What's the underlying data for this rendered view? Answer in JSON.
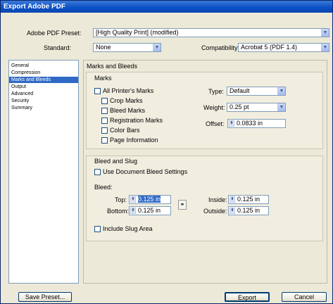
{
  "window": {
    "title": "Export Adobe PDF"
  },
  "header": {
    "preset_label": "Adobe PDF Preset:",
    "preset_value": "[High Quality Print] (modified)",
    "standard_label": "Standard:",
    "standard_value": "None",
    "compat_label": "Compatibility:",
    "compat_value": "Acrobat 5 (PDF 1.4)"
  },
  "sidebar": {
    "items": [
      {
        "label": "General"
      },
      {
        "label": "Compression"
      },
      {
        "label": "Marks and Bleeds"
      },
      {
        "label": "Output"
      },
      {
        "label": "Advanced"
      },
      {
        "label": "Security"
      },
      {
        "label": "Summary"
      }
    ],
    "selected": "Marks and Bleeds"
  },
  "panel": {
    "title": "Marks and Bleeds",
    "marks": {
      "heading": "Marks",
      "all_printers_marks": "All Printer's Marks",
      "crop_marks": "Crop Marks",
      "bleed_marks": "Bleed Marks",
      "registration_marks": "Registration Marks",
      "color_bars": "Color Bars",
      "page_information": "Page Information",
      "type_label": "Type:",
      "type_value": "Default",
      "weight_label": "Weight:",
      "weight_value": "0.25 pt",
      "offset_label": "Offset:",
      "offset_value": "0.0833 in"
    },
    "bleed": {
      "heading": "Bleed and Slug",
      "use_doc_settings": "Use Document Bleed Settings",
      "bleed_label": "Bleed:",
      "top_label": "Top:",
      "top_value": "0.125 in",
      "bottom_label": "Bottom:",
      "bottom_value": "0.125 in",
      "inside_label": "Inside:",
      "inside_value": "0.125 in",
      "outside_label": "Outside:",
      "outside_value": "0.125 in",
      "include_slug": "Include Slug Area"
    }
  },
  "footer": {
    "save_preset": "Save Preset...",
    "export": "Export",
    "cancel": "Cancel"
  },
  "colors": {
    "titlebar": "#0a4fc4",
    "selection": "#316ac5",
    "dialog_bg": "#ece9d8"
  }
}
